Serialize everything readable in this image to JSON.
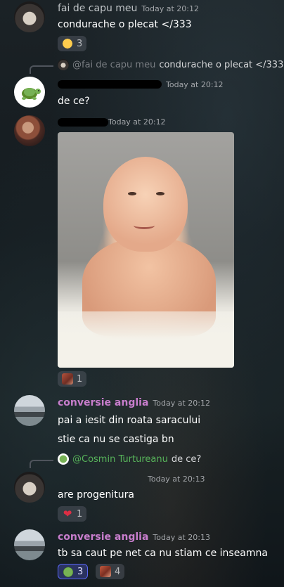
{
  "messages": [
    {
      "author": "fai de capu meu",
      "timestamp": "Today at 20:12",
      "text": "condurache o plecat </333",
      "reactions": [
        {
          "emoji": "crying-face",
          "count": "3"
        }
      ]
    },
    {
      "reply_to": {
        "mention": "@fai de capu meu",
        "text": "condurache o plecat </333"
      },
      "author_redacted": true,
      "timestamp": "Today at 20:12",
      "text": "de ce?"
    },
    {
      "author_redacted": true,
      "timestamp": "Today at 20:12",
      "image": "baby-photo",
      "reactions": [
        {
          "emoji": "painting-face",
          "count": "1"
        }
      ]
    },
    {
      "author": "conversie anglia",
      "timestamp": "Today at 20:12",
      "lines": [
        "pai a iesit din roata saracului",
        "stie ca nu se castiga bn"
      ]
    },
    {
      "reply_to": {
        "mention": "@Cosmin Turtureanu",
        "text": "de ce?"
      },
      "timestamp": "Today at 20:13",
      "text": "are progenitura",
      "reactions": [
        {
          "emoji": "red-heart",
          "count": "1"
        }
      ]
    },
    {
      "author": "conversie anglia",
      "timestamp": "Today at 20:13",
      "text": "tb sa caut pe net ca nu stiam ce inseamna",
      "reactions": [
        {
          "emoji": "frog",
          "count": "3",
          "active": true
        },
        {
          "emoji": "angry-face",
          "count": "4"
        }
      ]
    }
  ],
  "colors": {
    "author_pink": "#c77dcc",
    "mention_green": "#57b35a",
    "reaction_active_border": "#5865f2",
    "heart": "#dd2e44"
  }
}
